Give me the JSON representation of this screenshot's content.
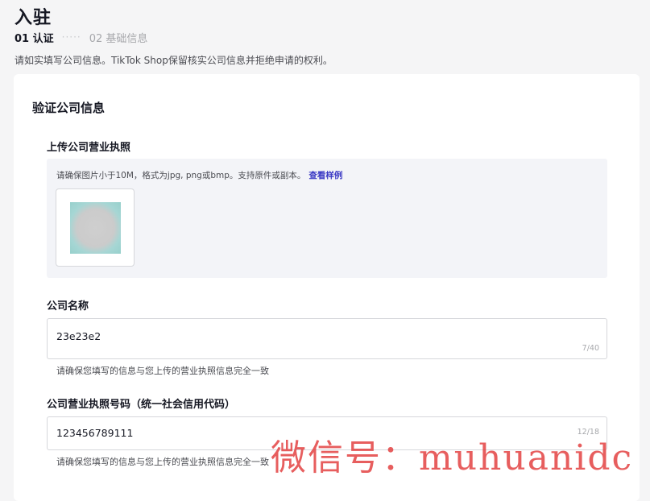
{
  "page": {
    "title": "入驻",
    "notice": "请如实填写公司信息。TikTok Shop保留核实公司信息并拒绝申请的权利。"
  },
  "steps": {
    "active": "01 认证",
    "dots": "·····",
    "inactive": "02 基础信息"
  },
  "card": {
    "title": "验证公司信息"
  },
  "license_upload": {
    "label": "上传公司营业执照",
    "hint": "请确保图片小于10M，格式为jpg, png或bmp。支持原件或副本。",
    "sample_link": "查看样例"
  },
  "company_name": {
    "label": "公司名称",
    "value": "23e23e2",
    "counter": "7/40",
    "helper": "请确保您填写的信息与您上传的营业执照信息完全一致"
  },
  "license_number": {
    "label": "公司营业执照号码（统一社会信用代码）",
    "value": "123456789111",
    "counter": "12/18",
    "helper": "请确保您填写的信息与您上传的营业执照信息完全一致"
  },
  "watermark": "微信号：muhuanidc"
}
